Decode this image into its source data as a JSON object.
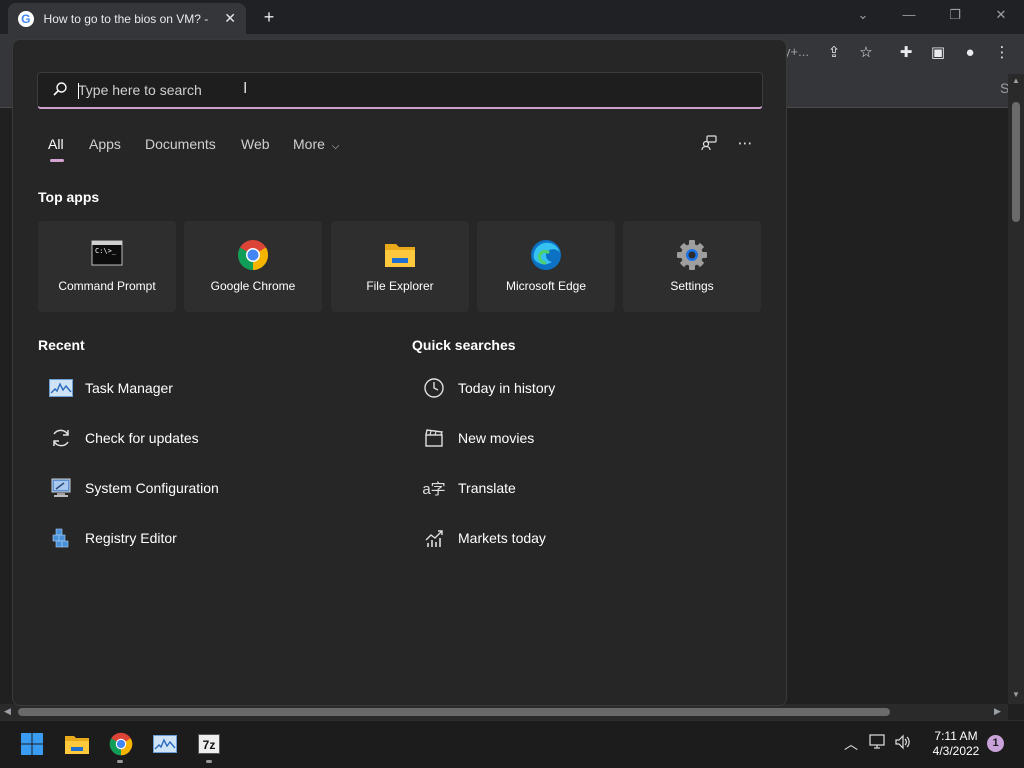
{
  "browser": {
    "tab_title": "How to go to the bios on VM? - ",
    "tab_close": "✕",
    "new_tab": "+",
    "toolbar_text": "y+...",
    "bookmark_s": "S"
  },
  "search": {
    "placeholder": "Type here to search",
    "value": ""
  },
  "filters": {
    "all": "All",
    "apps": "Apps",
    "documents": "Documents",
    "web": "Web",
    "more": "More"
  },
  "top_apps": {
    "heading": "Top apps",
    "items": [
      {
        "label": "Command Prompt",
        "icon": "command-prompt-icon"
      },
      {
        "label": "Google Chrome",
        "icon": "chrome-icon"
      },
      {
        "label": "File Explorer",
        "icon": "file-explorer-icon"
      },
      {
        "label": "Microsoft Edge",
        "icon": "edge-icon"
      },
      {
        "label": "Settings",
        "icon": "settings-gear-icon"
      }
    ]
  },
  "recent": {
    "heading": "Recent",
    "items": [
      {
        "label": "Task Manager",
        "icon": "task-manager-icon"
      },
      {
        "label": "Check for updates",
        "icon": "refresh-icon"
      },
      {
        "label": "System Configuration",
        "icon": "system-configuration-icon"
      },
      {
        "label": "Registry Editor",
        "icon": "registry-editor-icon"
      }
    ]
  },
  "quick_searches": {
    "heading": "Quick searches",
    "items": [
      {
        "label": "Today in history",
        "icon": "clock-icon"
      },
      {
        "label": "New movies",
        "icon": "clapperboard-icon"
      },
      {
        "label": "Translate",
        "icon": "translate-icon"
      },
      {
        "label": "Markets today",
        "icon": "chart-icon"
      }
    ]
  },
  "taskbar": {
    "time": "7:11 AM",
    "date": "4/3/2022",
    "notification_count": "1",
    "sevenzip_label": "7z"
  },
  "colors": {
    "accent": "#d4a3d4",
    "panel_bg": "#262626"
  }
}
